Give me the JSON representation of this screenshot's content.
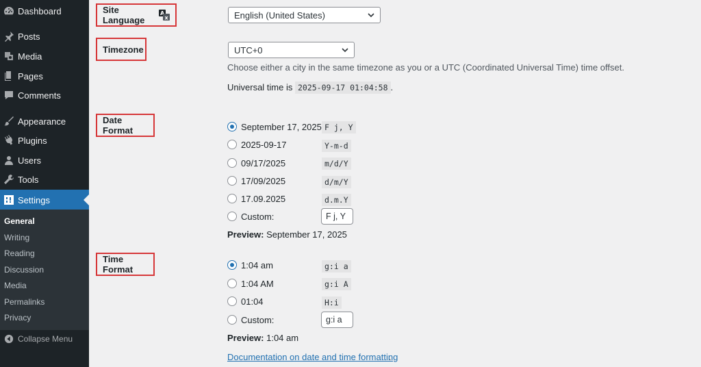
{
  "sidebar": {
    "items": [
      {
        "label": "Dashboard",
        "icon": "dashboard-icon"
      },
      {
        "label": "Posts",
        "icon": "pin-icon"
      },
      {
        "label": "Media",
        "icon": "media-icon"
      },
      {
        "label": "Pages",
        "icon": "pages-icon"
      },
      {
        "label": "Comments",
        "icon": "comments-icon"
      },
      {
        "label": "Appearance",
        "icon": "paintbrush-icon"
      },
      {
        "label": "Plugins",
        "icon": "plugin-icon"
      },
      {
        "label": "Users",
        "icon": "users-icon"
      },
      {
        "label": "Tools",
        "icon": "wrench-icon"
      },
      {
        "label": "Settings",
        "icon": "settings-icon",
        "active": true
      }
    ],
    "submenu": [
      "General",
      "Writing",
      "Reading",
      "Discussion",
      "Media",
      "Permalinks",
      "Privacy"
    ],
    "current_submenu": "General",
    "collapse_label": "Collapse Menu"
  },
  "site_language": {
    "label": "Site Language",
    "value": "English (United States)"
  },
  "timezone": {
    "label": "Timezone",
    "value": "UTC+0",
    "description": "Choose either a city in the same timezone as you or a UTC (Coordinated Universal Time) time offset.",
    "universal_prefix": "Universal time is",
    "universal_time": "2025-09-17 01:04:58",
    "universal_suffix": "."
  },
  "date_format": {
    "label": "Date Format",
    "options": [
      {
        "label": "September 17, 2025",
        "code": "F j, Y",
        "checked": true
      },
      {
        "label": "2025-09-17",
        "code": "Y-m-d",
        "checked": false
      },
      {
        "label": "09/17/2025",
        "code": "m/d/Y",
        "checked": false
      },
      {
        "label": "17/09/2025",
        "code": "d/m/Y",
        "checked": false
      },
      {
        "label": "17.09.2025",
        "code": "d.m.Y",
        "checked": false
      }
    ],
    "custom_label": "Custom:",
    "custom_value": "F j, Y",
    "preview_label": "Preview:",
    "preview_value": "September 17, 2025"
  },
  "time_format": {
    "label": "Time Format",
    "options": [
      {
        "label": "1:04 am",
        "code": "g:i a",
        "checked": true
      },
      {
        "label": "1:04 AM",
        "code": "g:i A",
        "checked": false
      },
      {
        "label": "01:04",
        "code": "H:i",
        "checked": false
      }
    ],
    "custom_label": "Custom:",
    "custom_value": "g:i a",
    "preview_label": "Preview:",
    "preview_value": "1:04 am"
  },
  "doc_link": {
    "text": "Documentation on date and time formatting",
    "suffix": "."
  },
  "colors": {
    "sidebar_bg": "#1d2327",
    "submenu_bg": "#2c3338",
    "accent": "#2271b1",
    "highlight_border": "#d63638",
    "page_bg": "#f0f0f1"
  }
}
